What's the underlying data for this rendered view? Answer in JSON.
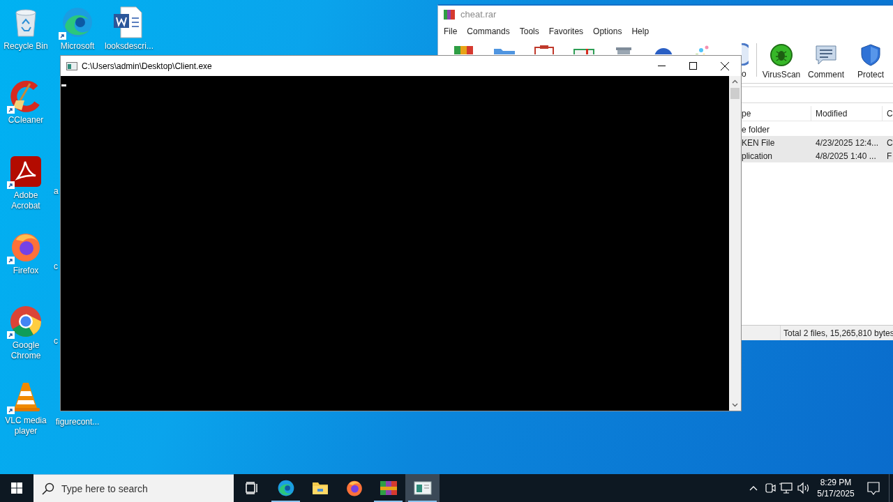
{
  "desktop_icons": [
    {
      "label": "Recycle Bin",
      "kind": "recycle-bin"
    },
    {
      "label": "CCleaner",
      "kind": "ccleaner"
    },
    {
      "label": "Adobe Acrobat",
      "kind": "acrobat"
    },
    {
      "label": "Firefox",
      "kind": "firefox"
    },
    {
      "label": "Google Chrome",
      "kind": "chrome"
    },
    {
      "label": "VLC media player",
      "kind": "vlc"
    },
    {
      "label": "Microsoft",
      "kind": "edge"
    },
    {
      "label": "a",
      "kind": "cut"
    },
    {
      "label": "c",
      "kind": "cut"
    },
    {
      "label": "c",
      "kind": "cut"
    },
    {
      "label": "figurecont...",
      "kind": "label-only"
    },
    {
      "label": "looksdescri...",
      "kind": "word"
    }
  ],
  "winrar": {
    "title": "cheat.rar",
    "menu": [
      "File",
      "Commands",
      "Tools",
      "Favorites",
      "Options",
      "Help"
    ],
    "covered_tools": [
      {
        "kind": "books"
      },
      {
        "kind": "folder"
      },
      {
        "kind": "clipboard"
      },
      {
        "kind": "book"
      },
      {
        "kind": "trash"
      },
      {
        "kind": "globe"
      },
      {
        "kind": "sparkle"
      }
    ],
    "toolbar": [
      {
        "label": "o",
        "kind": "info"
      },
      {
        "label": "VirusScan",
        "kind": "virusscan"
      },
      {
        "label": "Comment",
        "kind": "comment"
      },
      {
        "label": "Protect",
        "kind": "protect"
      }
    ],
    "columns": [
      "pe",
      "Modified",
      "C"
    ],
    "rows": [
      {
        "cells": [
          "e folder"
        ],
        "selected": false
      },
      {
        "cells": [
          "KEN File",
          "4/23/2025 12:4...",
          "C"
        ],
        "selected": true
      },
      {
        "cells": [
          "plication",
          "4/8/2025 1:40 ...",
          "F"
        ],
        "selected": true
      }
    ],
    "status": "Total 2 files, 15,265,810 bytes"
  },
  "console": {
    "title": "C:\\Users\\admin\\Desktop\\Client.exe"
  },
  "taskbar": {
    "search": {
      "placeholder": "Type here to search"
    },
    "apps": [
      {
        "kind": "task-view",
        "running": false,
        "selected": false
      },
      {
        "kind": "edge",
        "running": true,
        "selected": false
      },
      {
        "kind": "explorer",
        "running": false,
        "selected": false
      },
      {
        "kind": "firefox",
        "running": false,
        "selected": false
      },
      {
        "kind": "winrar",
        "running": true,
        "selected": false
      },
      {
        "kind": "console",
        "running": true,
        "selected": true
      }
    ],
    "time": "8:29 PM",
    "date": "5/17/2025"
  }
}
